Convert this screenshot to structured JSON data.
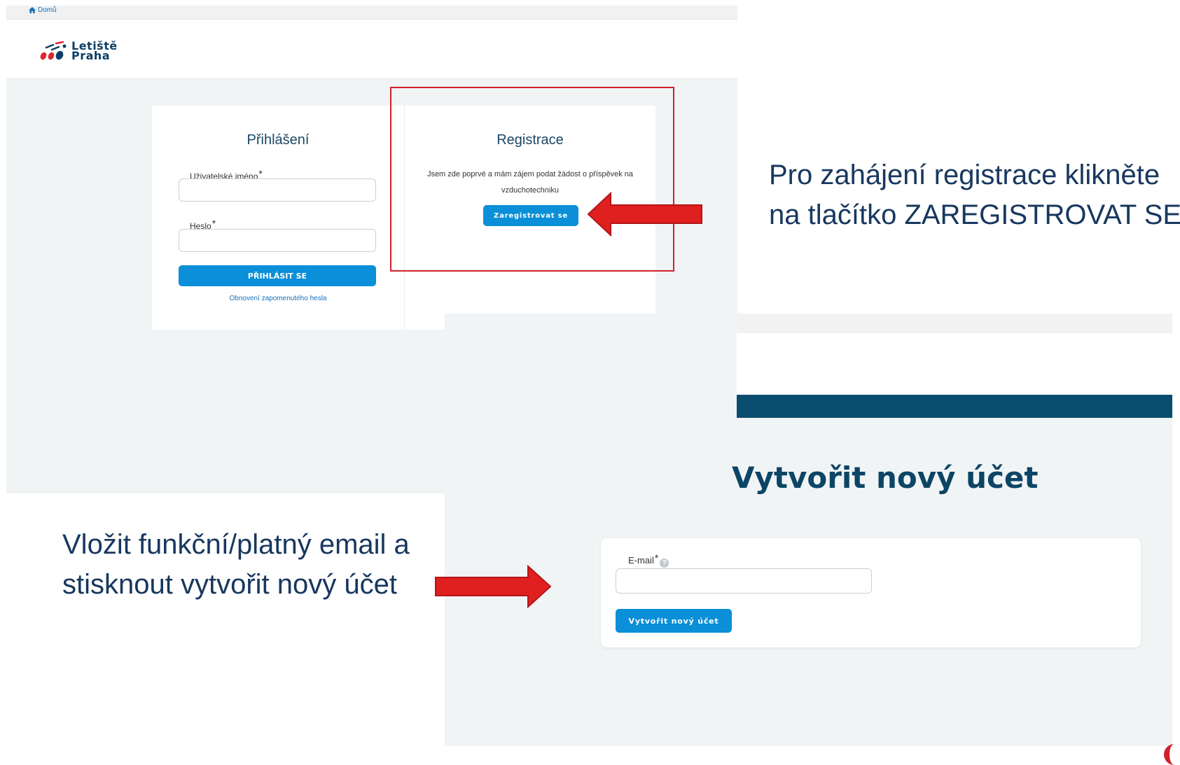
{
  "login_page": {
    "breadcrumb_home": "Domů",
    "logo_line1": "Letiště",
    "logo_line2": "Praha",
    "login": {
      "title": "Přihlášení",
      "username_label": "Uživatelské jméno",
      "username_value": "",
      "password_label": "Heslo",
      "password_value": "",
      "required_mark": "*",
      "submit_label": "PŘIHLÁSIT SE",
      "forgot_link": "Obnovení zapomenutého hesla"
    },
    "registration": {
      "title": "Registrace",
      "description": "Jsem zde poprvé a mám zájem podat žádost o příspěvek na vzduchotechniku",
      "register_button": "Zaregistrovat se"
    }
  },
  "create_account_page": {
    "title": "Vytvořit nový účet",
    "email_label": "E-mail",
    "required_mark": "*",
    "help_icon_glyph": "?",
    "email_value": "",
    "submit_label": "Vytvořit nový účet"
  },
  "annotations": {
    "register_instruction_line1": "Pro zahájení registrace klikněte",
    "register_instruction_line2": "na tlačítko ZAREGISTROVAT SE",
    "email_instruction": "Vložit  funkční/platný email a stisknout vytvořit nový účet"
  },
  "colors": {
    "highlight_red": "#d11f2a",
    "button_blue": "#0a8fd8",
    "dark_navy": "#0c4566",
    "annotation_text": "#17375e"
  },
  "icons": {
    "home": "home-icon",
    "logo": "letiste-praha-logo-icon",
    "help": "help-icon"
  }
}
